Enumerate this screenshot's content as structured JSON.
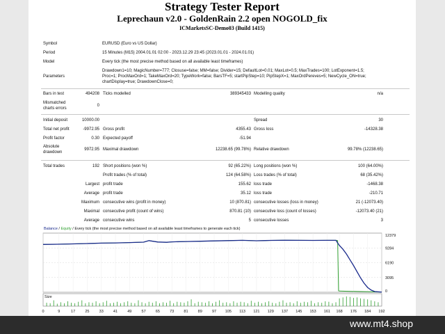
{
  "header": {
    "title": "Strategy Tester Report",
    "subtitle": "Leprechaun v2.0 - GoldenRain 2.2 open NOGOLD_fix",
    "server": "ICMarketsSC-Demo03 (Build 1415)"
  },
  "info": {
    "symbol_label": "Symbol",
    "symbol_value": "EURUSD (Euro vs US Dollar)",
    "period_label": "Period",
    "period_value": "15 Minutes (M15) 2004.01.01 02:00 - 2023.12.29 23:45 (2023.01.01 - 2024.01.01)",
    "model_label": "Model",
    "model_value": "Every tick (the most precise method based on all available least timeframes)",
    "parameters_label": "Parameters",
    "parameters_lines": [
      "Drawdown1=10; MagicNumber=777; Closuse=false; MM=false; Divider=15; DefaultLot=0.01; MaxLot=0.5; MaxTrades=100; LotExponent=1.5;",
      "Proc=1; ProcMaxOrd=1; TakeMaxOrd=20; TypeWork=false; BarsTF=5; startPipStep=10; PipStepX=1; MaxOrdPereves=5; NewCycle_ON=true;",
      "chartDisplay=true; DrawdownClose=0;"
    ]
  },
  "quality": {
    "bars_label": "Bars in test",
    "bars_value": "494208",
    "ticks_label": "Ticks modelled",
    "ticks_value": "389345433",
    "modelq_label": "Modelling quality",
    "modelq_value": "n/a",
    "mismatch_label_1": "Mismatched",
    "mismatch_label_2": "charts errors",
    "mismatch_value": "0"
  },
  "stats": {
    "initial_deposit_label": "Initial deposit",
    "initial_deposit_value": "10000.00",
    "spread_label": "Spread",
    "spread_value": "30",
    "net_profit_label": "Total net profit",
    "net_profit_value": "-9972.95",
    "gross_profit_label": "Gross profit",
    "gross_profit_value": "4355.43",
    "gross_loss_label": "Gross loss",
    "gross_loss_value": "-14328.38",
    "profit_factor_label": "Profit factor",
    "profit_factor_value": "0.30",
    "expected_payoff_label": "Expected payoff",
    "expected_payoff_value": "-51.94",
    "abs_dd_label_1": "Absolute",
    "abs_dd_label_2": "drawdown",
    "abs_dd_value": "9972.95",
    "max_dd_label": "Maximal drawdown",
    "max_dd_value": "12238.65 (99.78%)",
    "rel_dd_label": "Relative drawdown",
    "rel_dd_value": "99.78% (12238.65)",
    "total_trades_label": "Total trades",
    "total_trades_value": "192",
    "short_label": "Short positions (won %)",
    "short_value": "92 (65.22%)",
    "long_label": "Long positions (won %)",
    "long_value": "100 (64.00%)",
    "profit_trades_label": "Profit trades (% of total)",
    "profit_trades_value": "124 (64.58%)",
    "loss_trades_label": "Loss trades (% of total)",
    "loss_trades_value": "68 (35.42%)",
    "largest_label": "Largest",
    "largest_profit_label": "profit trade",
    "largest_profit_value": "155.62",
    "largest_loss_label": "loss trade",
    "largest_loss_value": "-1468.38",
    "average_label": "Average",
    "avg_profit_label": "profit trade",
    "avg_profit_value": "35.12",
    "avg_loss_label": "loss trade",
    "avg_loss_value": "-210.71",
    "maximum_label": "Maximum",
    "max_cw_label": "consecutive wins (profit in money)",
    "max_cw_value": "10 (870.81)",
    "max_cl_label": "consecutive losses (loss in money)",
    "max_cl_value": "21 (-12073.40)",
    "maximal_label": "Maximal",
    "mcp_label": "consecutive profit (count of wins)",
    "mcp_value": "870.81 (10)",
    "mcl_label": "consecutive loss (count of losses)",
    "mcl_value": "-12073.40 (21)",
    "average2_label": "Average",
    "acw_label": "consecutive wins",
    "acw_value": "5",
    "acl_label": "consecutive losses",
    "acl_value": "3"
  },
  "chart_legend": {
    "balance": "Balance",
    "sep": " / ",
    "equity": "Equity",
    "rest": " / Every tick (the most precise method based on all available least timeframes to generate each tick)"
  },
  "colors": {
    "balance": "#1a2a8c",
    "equity": "#2e9e2e",
    "size_bars": "#2e9e2e",
    "footer": "#2c2c2c"
  },
  "footer": {
    "watermark": "www.mt4.shop"
  },
  "chart_data": {
    "type": "line",
    "y_ticks": [
      "12379",
      "9284",
      "6190",
      "3095",
      "0"
    ],
    "ylim": [
      0,
      12379
    ],
    "x_ticks": [
      "0",
      "9",
      "17",
      "25",
      "33",
      "41",
      "49",
      "57",
      "65",
      "73",
      "81",
      "89",
      "97",
      "105",
      "113",
      "121",
      "129",
      "137",
      "145",
      "153",
      "161",
      "168",
      "176",
      "184",
      "192"
    ],
    "xlim": [
      0,
      192
    ],
    "series": [
      {
        "name": "Balance",
        "x": [
          0,
          8,
          17,
          25,
          33,
          41,
          49,
          57,
          60,
          65,
          70,
          73,
          81,
          89,
          97,
          105,
          113,
          121,
          129,
          137,
          145,
          153,
          161,
          166,
          168,
          170,
          172,
          174,
          176,
          178,
          180,
          182,
          184,
          186,
          188,
          192
        ],
        "y": [
          10000,
          10050,
          10120,
          10200,
          10280,
          10330,
          10400,
          10480,
          10800,
          10520,
          10450,
          10550,
          10620,
          10680,
          10750,
          10800,
          10870,
          10780,
          10850,
          10880,
          10860,
          10850,
          10870,
          10870,
          9800,
          9000,
          8000,
          6800,
          5600,
          4300,
          3000,
          1900,
          1000,
          450,
          150,
          27
        ]
      },
      {
        "name": "Equity",
        "x": [
          0,
          8,
          17,
          25,
          33,
          41,
          49,
          57,
          60,
          65,
          70,
          73,
          81,
          89,
          97,
          105,
          113,
          121,
          129,
          137,
          145,
          153,
          161,
          166,
          167,
          167.5,
          168,
          184,
          192
        ],
        "y": [
          10000,
          10050,
          10120,
          10200,
          10280,
          10330,
          10400,
          10480,
          10800,
          10520,
          10450,
          10550,
          10620,
          10680,
          10750,
          10800,
          10870,
          10780,
          10850,
          10880,
          10860,
          10850,
          10870,
          10870,
          10800,
          300,
          250,
          100,
          27
        ]
      }
    ],
    "size_label": "Size",
    "size_bars": {
      "x": [
        2,
        4,
        6,
        8,
        10,
        12,
        14,
        16,
        18,
        20,
        22,
        24,
        26,
        28,
        30,
        32,
        34,
        36,
        38,
        40,
        42,
        44,
        46,
        48,
        50,
        52,
        54,
        56,
        58,
        60,
        62,
        64,
        66,
        68,
        70,
        72,
        74,
        76,
        78,
        80,
        82,
        84,
        86,
        88,
        90,
        92,
        94,
        96,
        98,
        100,
        102,
        104,
        106,
        108,
        110,
        112,
        114,
        116,
        118,
        120,
        122,
        124,
        126,
        128,
        130,
        132,
        134,
        136,
        138,
        140,
        142,
        144,
        146,
        148,
        150,
        152,
        154,
        156,
        158,
        160,
        162,
        164,
        166,
        168,
        170,
        172,
        174,
        176,
        178,
        180,
        182,
        184,
        186,
        188,
        190
      ],
      "y": [
        0.35,
        0.3,
        0.6,
        0.25,
        0.4,
        0.3,
        0.5,
        0.35,
        0.3,
        0.45,
        0.6,
        0.3,
        0.4,
        0.35,
        0.5,
        0.3,
        0.4,
        0.55,
        0.3,
        0.35,
        0.45,
        0.3,
        0.4,
        0.5,
        0.35,
        0.3,
        0.6,
        0.4,
        0.3,
        0.45,
        0.35,
        0.5,
        0.3,
        0.4,
        0.35,
        0.55,
        0.3,
        0.45,
        0.4,
        0.35,
        0.5,
        0.7,
        0.3,
        0.45,
        0.4,
        0.35,
        0.5,
        0.3,
        0.45,
        0.6,
        0.35,
        0.4,
        0.3,
        0.5,
        0.35,
        0.45,
        0.4,
        0.3,
        0.55,
        0.35,
        0.45,
        0.3,
        0.4,
        0.5,
        0.35,
        0.3,
        0.45,
        0.6,
        0.35,
        0.4,
        0.3,
        0.5,
        0.35,
        0.45,
        0.4,
        0.55,
        0.3,
        0.4,
        0.35,
        0.5,
        0.45,
        0.3,
        0.4,
        0.8,
        0.9,
        1.0,
        0.95,
        0.85,
        0.9,
        0.8,
        0.75,
        0.7,
        0.6,
        0.5,
        0.4
      ]
    }
  }
}
